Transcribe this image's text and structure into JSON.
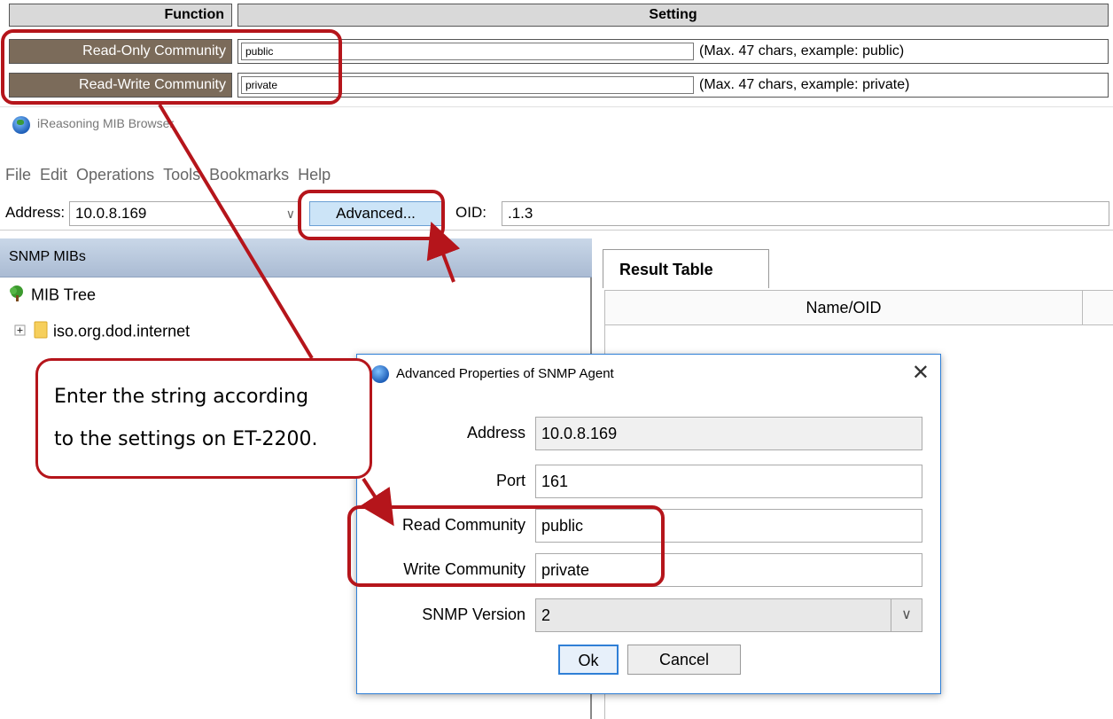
{
  "settings_table": {
    "header_function": "Function",
    "header_setting": "Setting",
    "rows": [
      {
        "label": "Read-Only Community",
        "value": "public",
        "hint": "(Max. 47 chars, example: public)"
      },
      {
        "label": "Read-Write Community",
        "value": "private",
        "hint": "(Max. 47 chars, example: private)"
      }
    ]
  },
  "browser": {
    "title": "iReasoning MIB Browser",
    "menu": [
      "File",
      "Edit",
      "Operations",
      "Tools",
      "Bookmarks",
      "Help"
    ],
    "address_label": "Address:",
    "address_value": "10.0.8.169",
    "advanced_button": "Advanced...",
    "oid_label": "OID:",
    "oid_value": ".1.3",
    "left_pane_title": "SNMP MIBs",
    "tree_root": "MIB Tree",
    "tree_child": "iso.org.dod.internet",
    "result_tab": "Result Table",
    "column_name": "Name/OID"
  },
  "dialog": {
    "title": "Advanced Properties of SNMP Agent",
    "fields": [
      {
        "label": "Address",
        "value": "10.0.8.169"
      },
      {
        "label": "Port",
        "value": "161"
      },
      {
        "label": "Read Community",
        "value": "public"
      },
      {
        "label": "Write Community",
        "value": "private"
      }
    ],
    "version_label": "SNMP Version",
    "version_value": "2",
    "ok_label": "Ok",
    "cancel_label": "Cancel"
  },
  "annotation": {
    "line1": "Enter the string according",
    "line2": "to the settings on ET-2200."
  },
  "colors": {
    "highlight": "#b5151b",
    "label_bg": "#7b6b5a",
    "dialog_border": "#2f7fd6"
  }
}
